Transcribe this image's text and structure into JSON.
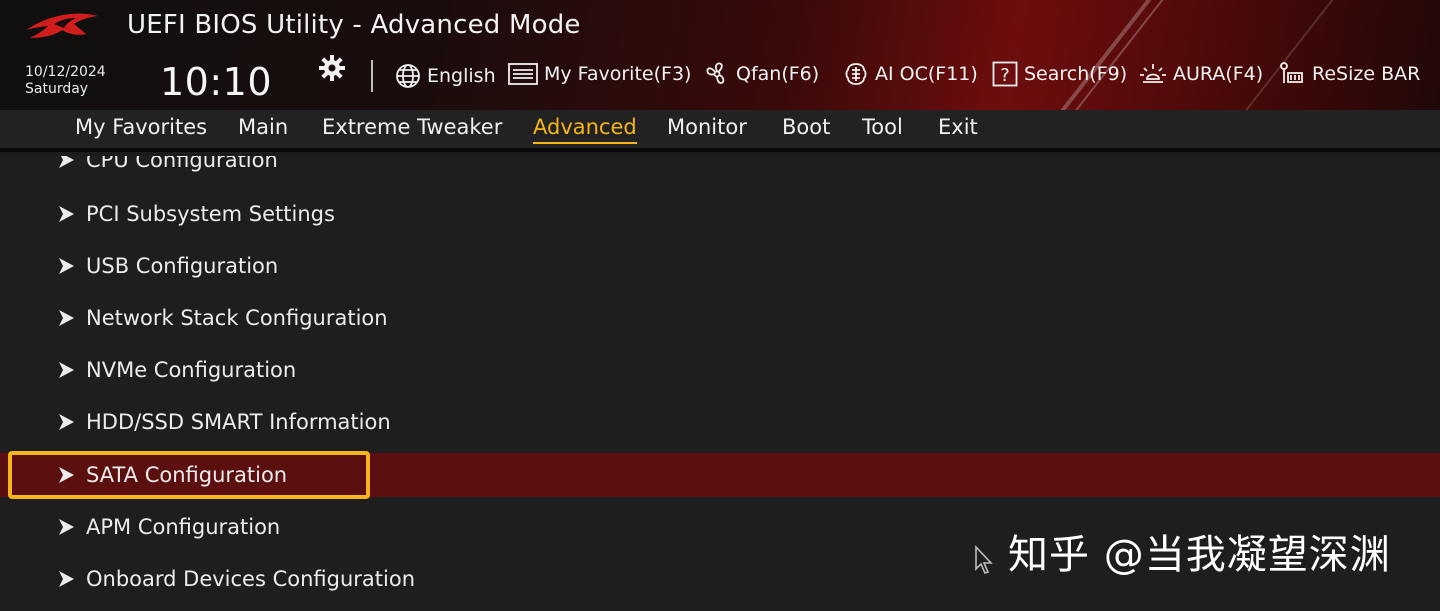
{
  "header": {
    "title": "UEFI BIOS Utility - Advanced Mode",
    "date": "10/12/2024",
    "weekday": "Saturday",
    "time": "10:10",
    "tools": {
      "language": "English",
      "my_favorite": "My Favorite(F3)",
      "qfan": "Qfan(F6)",
      "ai_oc": "AI OC(F11)",
      "search": "Search(F9)",
      "aura": "AURA(F4)",
      "resize_bar": "ReSize BAR"
    },
    "icons": [
      "rog-logo",
      "gear-icon",
      "globe-icon",
      "list-icon",
      "fan-icon",
      "chip-icon",
      "question-icon",
      "aura-icon",
      "resize-bar-icon"
    ]
  },
  "menu": {
    "items": [
      "My Favorites",
      "Main",
      "Extreme Tweaker",
      "Advanced",
      "Monitor",
      "Boot",
      "Tool",
      "Exit"
    ],
    "active": "Advanced"
  },
  "list": {
    "items": [
      "CPU Configuration",
      "PCI Subsystem Settings",
      "USB Configuration",
      "Network Stack Configuration",
      "NVMe Configuration",
      "HDD/SSD SMART Information",
      "SATA Configuration",
      "APM Configuration",
      "Onboard Devices Configuration"
    ],
    "selected": "SATA Configuration"
  },
  "watermark": "知乎 @当我凝望深渊",
  "colors": {
    "accent": "#f5b51b",
    "selected_row": "#5c0f0f",
    "background": "#1e1e1e",
    "menubar": "#222222"
  }
}
